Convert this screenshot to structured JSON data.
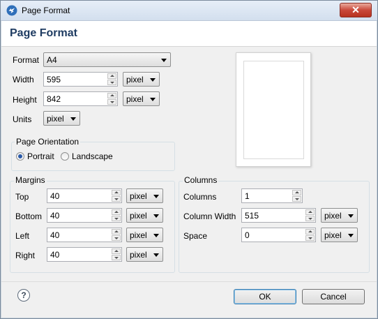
{
  "window": {
    "title": "Page Format",
    "close_label": "✕"
  },
  "header": {
    "heading": "Page Format"
  },
  "format": {
    "label": "Format",
    "value": "A4"
  },
  "width": {
    "label": "Width",
    "value": "595",
    "unit": "pixel"
  },
  "height": {
    "label": "Height",
    "value": "842",
    "unit": "pixel"
  },
  "units": {
    "label": "Units",
    "value": "pixel"
  },
  "orientation": {
    "title": "Page Orientation",
    "portrait_label": "Portrait",
    "landscape_label": "Landscape",
    "selected": "Portrait"
  },
  "margins": {
    "title": "Margins",
    "rows": [
      {
        "label": "Top",
        "value": "40",
        "unit": "pixel"
      },
      {
        "label": "Bottom",
        "value": "40",
        "unit": "pixel"
      },
      {
        "label": "Left",
        "value": "40",
        "unit": "pixel"
      },
      {
        "label": "Right",
        "value": "40",
        "unit": "pixel"
      }
    ]
  },
  "columns": {
    "title": "Columns",
    "count": {
      "label": "Columns",
      "value": "1"
    },
    "column_width": {
      "label": "Column Width",
      "value": "515",
      "unit": "pixel"
    },
    "space": {
      "label": "Space",
      "value": "0",
      "unit": "pixel"
    }
  },
  "footer": {
    "help_label": "?",
    "ok_label": "OK",
    "cancel_label": "Cancel"
  },
  "colors": {
    "heading": "#1f3c62",
    "accent": "#2a5aa8"
  }
}
